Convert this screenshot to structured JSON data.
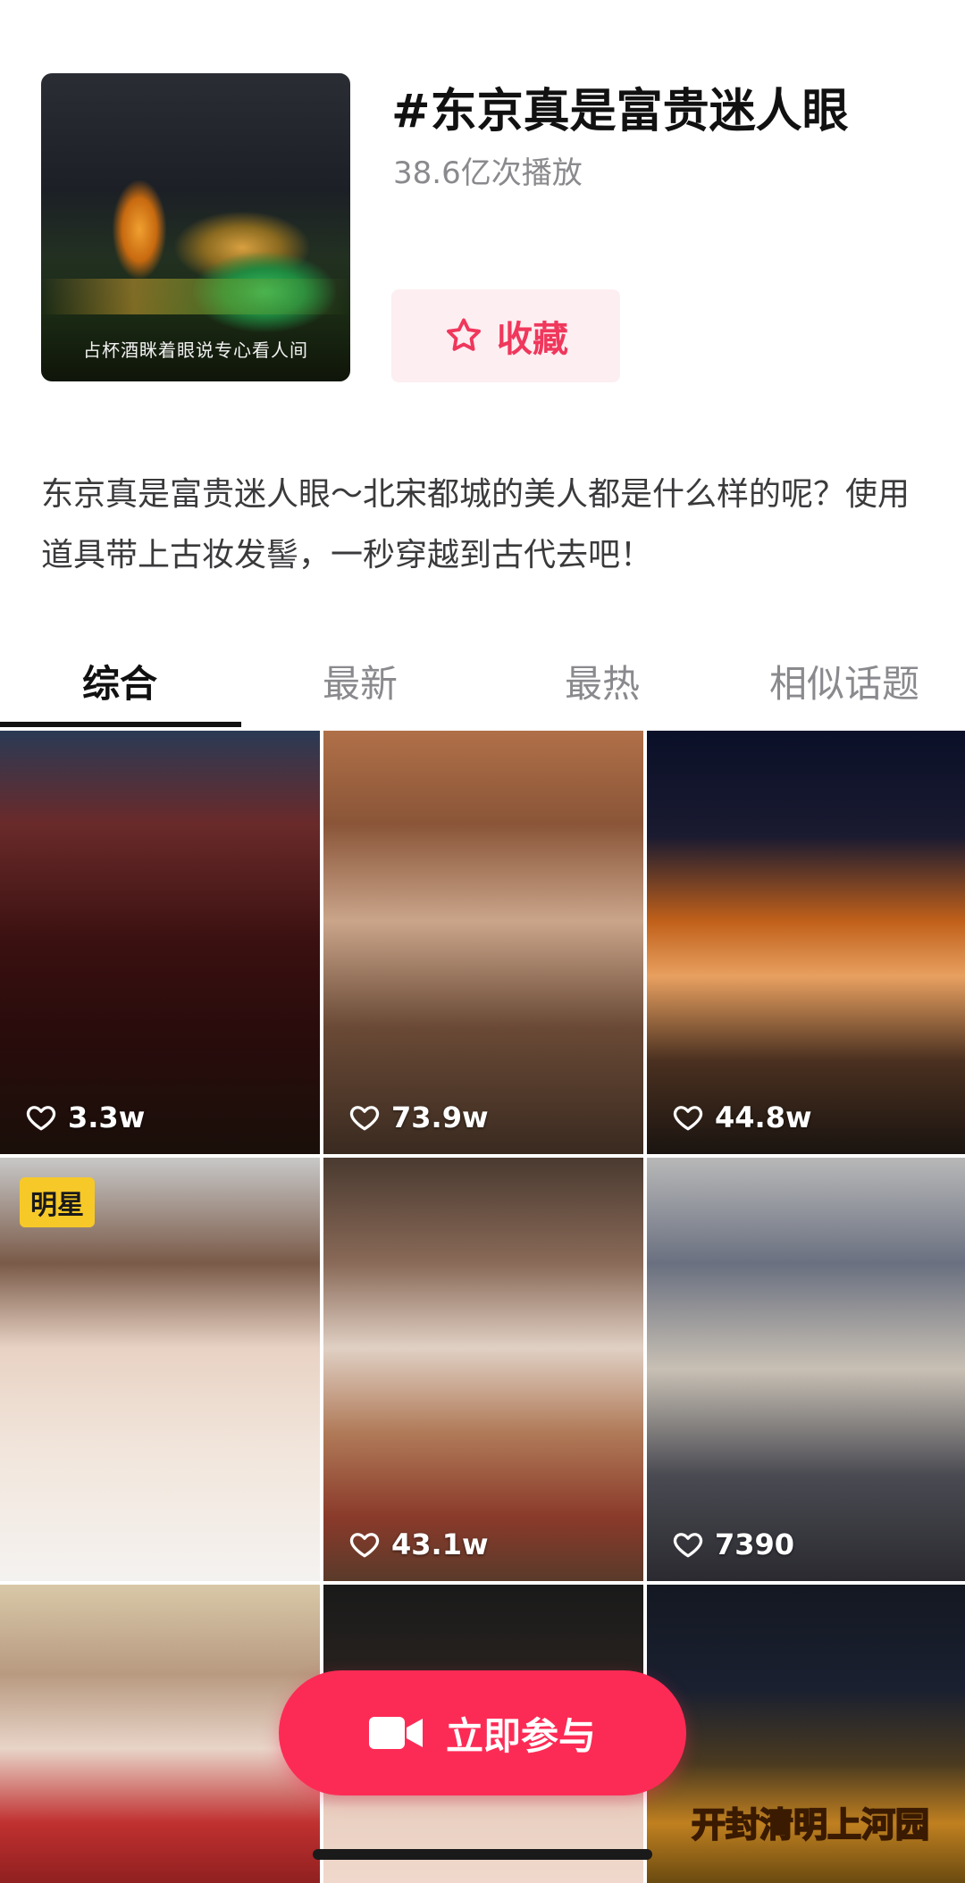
{
  "topic": {
    "cover_caption": "占杯酒眯着眼说专心看人间",
    "title": "#东京真是富贵迷人眼",
    "play_count": "38.6亿次播放",
    "favorite_label": "收藏",
    "description": "东京真是富贵迷人眼～北宋都城的美人都是什么样的呢？使用道具带上古妆发髻，一秒穿越到古代去吧！"
  },
  "tabs": [
    {
      "label": "综合",
      "active": true
    },
    {
      "label": "最新",
      "active": false
    },
    {
      "label": "最热",
      "active": false
    },
    {
      "label": "相似话题",
      "active": false
    }
  ],
  "videos": [
    {
      "likes": "3.3w"
    },
    {
      "likes": "73.9w"
    },
    {
      "likes": "44.8w"
    },
    {
      "likes": "",
      "badge": "明星"
    },
    {
      "likes": "43.1w"
    },
    {
      "likes": "7390"
    },
    {
      "likes": ""
    },
    {
      "likes": ""
    },
    {
      "likes": "",
      "overlay_text": "开封清明上河园"
    }
  ],
  "join_button": {
    "label": "立即参与"
  },
  "colors": {
    "accent": "#fc2b55",
    "favorite_text": "#f0375c",
    "favorite_bg": "#fdeef1",
    "badge_bg": "#f7c928"
  },
  "icons": {
    "favorite": "star-outline-icon",
    "likes": "heart-outline-icon",
    "join": "video-camera-icon"
  }
}
